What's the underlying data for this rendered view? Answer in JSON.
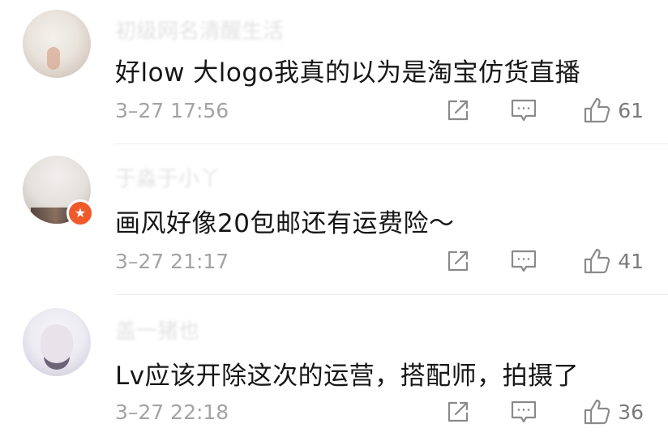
{
  "comments": [
    {
      "username": "初级网名清醒生活",
      "text": "好low 大logo我真的以为是淘宝仿货直播",
      "time": "3–27 17:56",
      "likes": "61",
      "verified": false
    },
    {
      "username": "于淼于小丫",
      "text": "画风好像20包邮还有运费险～",
      "time": "3–27 21:17",
      "likes": "41",
      "verified": true
    },
    {
      "username": "盖一猪也",
      "text": "Lv应该开除这次的运营，搭配师，拍摄了",
      "time": "3–27 22:18",
      "likes": "36",
      "verified": false
    }
  ],
  "colors": {
    "text": "#161616",
    "meta": "#a3a3a3",
    "icon": "#8a8a8a",
    "badge": "#f0592a"
  },
  "icons": [
    "share-icon",
    "comment-icon",
    "thumbs-up-icon",
    "verified-badge-icon"
  ]
}
